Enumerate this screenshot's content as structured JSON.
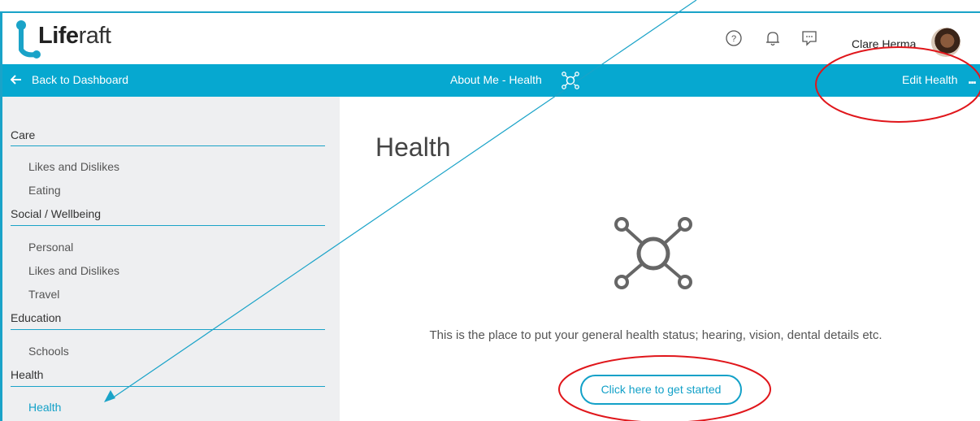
{
  "app": {
    "logo_bold": "Life",
    "logo_light": "raft"
  },
  "header": {
    "user_name": "Clare Herma"
  },
  "bar": {
    "back_label": "Back to Dashboard",
    "title": "About Me - Health",
    "edit_label": "Edit Health",
    "more_label": "..."
  },
  "sidebar": {
    "sections": [
      {
        "label": "Care",
        "items": [
          "Likes and Dislikes",
          "Eating"
        ]
      },
      {
        "label": "Social / Wellbeing",
        "items": [
          "Personal",
          "Likes and Dislikes",
          "Travel"
        ]
      },
      {
        "label": "Education",
        "items": [
          "Schools"
        ]
      },
      {
        "label": "Health",
        "items": [
          "Health"
        ]
      }
    ]
  },
  "main": {
    "title": "Health",
    "description": "This is the place to put your general health status; hearing, vision, dental details etc.",
    "cta_label": "Click here to get started"
  },
  "colors": {
    "accent": "#06a8d0",
    "annotation": "#e0161b"
  },
  "icons": [
    "help-icon",
    "bell-icon",
    "chat-icon",
    "arrow-left-icon",
    "network-icon"
  ]
}
